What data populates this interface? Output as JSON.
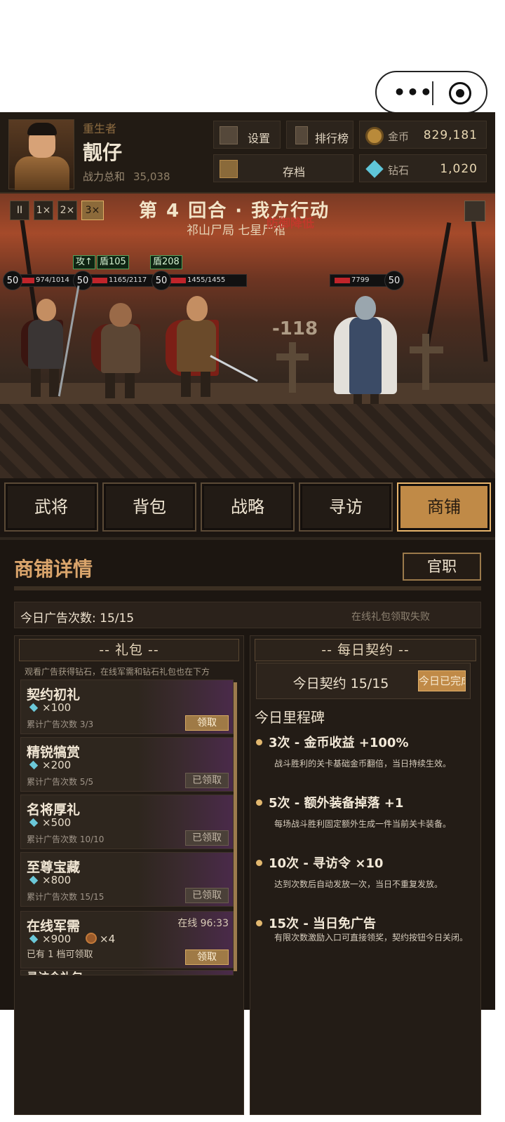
{
  "header": {
    "role": "重生者",
    "name": "靓仔",
    "power_label": "战力总和",
    "power_value": "35,038",
    "settings_label": "设置",
    "ranking_label": "排行榜",
    "save_label": "存档",
    "gold_label": "金币",
    "gold_value": "829,181",
    "diamond_label": "钻石",
    "diamond_value": "1,020"
  },
  "battle": {
    "speed_options": [
      "II",
      "1×",
      "2×",
      "3×"
    ],
    "speed_selected": "3×",
    "round_text": "第 4 回合 · 我方行动",
    "stage_text": "祁山尸局 七星尸棺",
    "debuff_text": "防御降低",
    "damage_text": "-118",
    "allies": [
      {
        "level": "50",
        "hp": "974/1014"
      },
      {
        "level": "50",
        "hp": "1165/2117"
      },
      {
        "level": "50",
        "hp": "1455/1455"
      }
    ],
    "buffs": [
      "攻↑",
      "盾105",
      "盾208"
    ],
    "enemy": {
      "level": "50",
      "hp": "7799"
    }
  },
  "tabs": [
    {
      "label": "武将"
    },
    {
      "label": "背包"
    },
    {
      "label": "战略"
    },
    {
      "label": "寻访"
    },
    {
      "label": "商铺"
    }
  ],
  "active_tab": "商铺",
  "shop": {
    "title": "商铺详情",
    "official_button": "官职",
    "ad_count_label": "今日广告次数: 15/15",
    "ad_status": "在线礼包领取失败",
    "gifts_header": "-- 礼包 --",
    "gifts_hint": "观看广告获得钻石，在线军需和钻石礼包也在下方",
    "gifts": [
      {
        "name": "契约初礼",
        "qty": "×100",
        "count": "累计广告次数 3/3",
        "button": "领取"
      },
      {
        "name": "精锐犒赏",
        "qty": "×200",
        "count": "累计广告次数 5/5",
        "button": "已领取"
      },
      {
        "name": "名将厚礼",
        "qty": "×500",
        "count": "累计广告次数 10/10",
        "button": "已领取"
      },
      {
        "name": "至尊宝藏",
        "qty": "×800",
        "count": "累计广告次数 15/15",
        "button": "已领取"
      },
      {
        "name": "在线军需",
        "qty": "×900",
        "qty2": "×4",
        "online": "在线 96:33",
        "count": "已有 1 档可领取",
        "button": "领取"
      }
    ],
    "gift_partial_name": "寻访令礼包",
    "contract_header": "-- 每日契约 --",
    "contract_label": "今日契约 15/15",
    "contract_button": "今日已完成",
    "milestone_title": "今日里程碑",
    "milestones": [
      {
        "title": "3次 - 金币收益 +100%",
        "desc": "战斗胜利的关卡基础金币翻倍，当日持续生效。"
      },
      {
        "title": "5次 - 额外装备掉落 +1",
        "desc": "每场战斗胜利固定额外生成一件当前关卡装备。"
      },
      {
        "title": "10次 - 寻访令 ×10",
        "desc": "达到次数后自动发放一次，当日不重复发放。"
      },
      {
        "title": "15次 - 当日免广告",
        "desc": "有限次数激励入口可直接领奖，契约按钮今日关闭。"
      }
    ]
  }
}
